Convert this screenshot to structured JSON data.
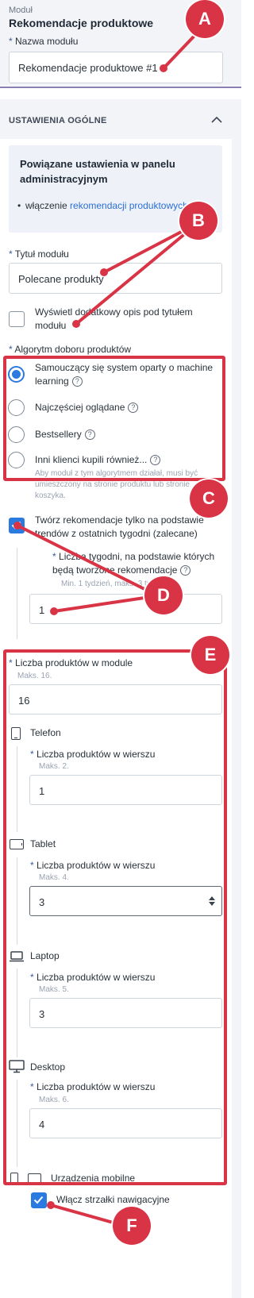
{
  "header": {
    "eyebrow": "Moduł",
    "title": "Rekomendacje produktowe",
    "module_name_label": "Nazwa modułu",
    "module_name_value": "Rekomendacje produktowe #1"
  },
  "section": {
    "title": "USTAWIENIA OGÓLNE"
  },
  "info_box": {
    "title": "Powiązane ustawienia w panelu administracyjnym",
    "bullet_prefix": "włączenie",
    "link_text": "rekomendacji produktowych"
  },
  "module_title": {
    "label": "Tytuł modułu",
    "value": "Polecane produkty"
  },
  "show_description": {
    "label": "Wyświetl dodatkowy opis pod tytułem modułu",
    "checked": false
  },
  "algorithm": {
    "label": "Algorytm doboru produktów",
    "options": [
      {
        "label": "Samouczący się system oparty o machine learning",
        "selected": true
      },
      {
        "label": "Najczęściej oglądane",
        "selected": false
      },
      {
        "label": "Bestsellery",
        "selected": false
      },
      {
        "label": "Inni klienci kupili również...",
        "selected": false
      }
    ],
    "hint": "Aby moduł z tym algorytmem działał, musi być umieszczony na stronie produktu lub stronie koszyka."
  },
  "trends": {
    "label": "Twórz rekomendacje tylko na podstawie trendów z ostatnich tygodni (zalecane)",
    "checked": true,
    "weeks_label": "Liczba tygodni, na podstawie których będą tworzone rekomendacje",
    "weeks_hint": "Min. 1 tydzień, maks. 3 tyg.",
    "weeks_value": "1"
  },
  "products": {
    "label": "Liczba produktów w module",
    "hint": "Maks. 16.",
    "value": "16"
  },
  "devices": [
    {
      "name": "Telefon",
      "icon": "phone-icon",
      "per_row_label": "Liczba produktów w wierszu",
      "hint": "Maks. 2.",
      "value": "1"
    },
    {
      "name": "Tablet",
      "icon": "tablet-icon",
      "per_row_label": "Liczba produktów w wierszu",
      "hint": "Maks. 4.",
      "value": "3"
    },
    {
      "name": "Laptop",
      "icon": "laptop-icon",
      "per_row_label": "Liczba produktów w wierszu",
      "hint": "Maks. 5.",
      "value": "3"
    },
    {
      "name": "Desktop",
      "icon": "desktop-icon",
      "per_row_label": "Liczba produktów w wierszu",
      "hint": "Maks. 6.",
      "value": "4"
    }
  ],
  "mobile": {
    "label": "Urządzenia mobilne",
    "arrows_label": "Włącz strzałki nawigacyjne",
    "arrows_checked": true
  },
  "annotations": [
    "A",
    "B",
    "C",
    "D",
    "E",
    "F"
  ],
  "colors": {
    "annotation_red": "#d93446",
    "accent_blue": "#2b7ae0",
    "section_bg": "#f3f4f7",
    "divider_purple": "#8a7fb4"
  }
}
